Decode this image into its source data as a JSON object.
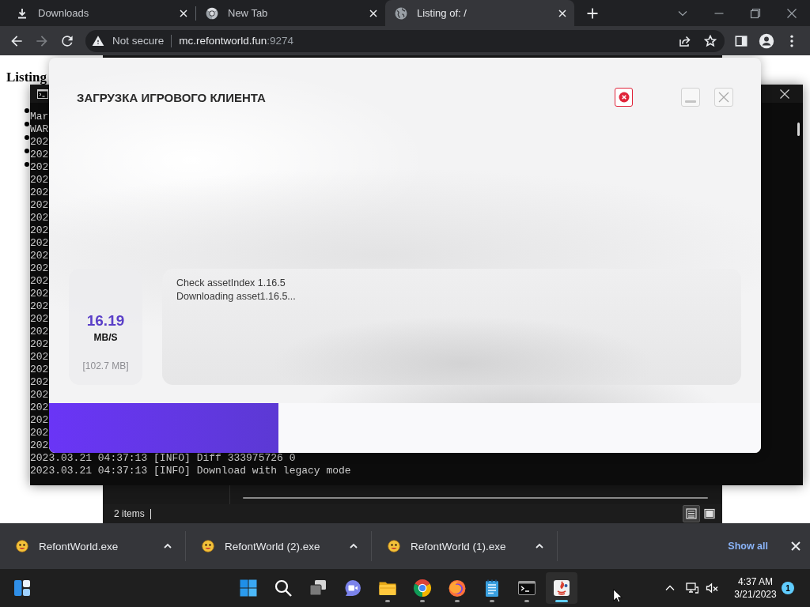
{
  "browser": {
    "tabs": [
      {
        "kind": "downloads",
        "label": "Downloads",
        "selected": false
      },
      {
        "kind": "chrome",
        "label": "New Tab",
        "selected": false
      },
      {
        "kind": "globe",
        "label": "Listing of: /",
        "selected": true
      }
    ]
  },
  "toolbar": {
    "forward_disabled": true,
    "security": "Not secure",
    "host": "mc.refontworld.fun",
    "port": ":9274"
  },
  "page": {
    "heading": "Listing"
  },
  "explorer": {
    "status": "2 items",
    "views": [
      {
        "kind": "details",
        "selected": true
      },
      {
        "kind": "tiles",
        "selected": false
      }
    ]
  },
  "console": {
    "lines": [
      "Mar",
      "WAR",
      "202",
      "202",
      "202",
      "202",
      "202",
      "202",
      "202",
      "202",
      "202",
      "202",
      "202",
      "202",
      "202",
      "202",
      "202",
      "202",
      "202",
      "202",
      "202",
      "202",
      "202",
      "202",
      "202",
      "202",
      "202",
      "2023.03.21 04:37:13 [INFO] Diff 333975726 0",
      "2023.03.21 04:37:13 [INFO] Download with legacy mode"
    ]
  },
  "dialog": {
    "title": "ЗАГРУЗКА ИГРОВОГО КЛИЕНТА",
    "buttons": [
      {
        "kind": "cancel"
      },
      {
        "kind": "minimize"
      },
      {
        "kind": "close"
      }
    ],
    "speed": {
      "value": "16.19",
      "unit": "MB/S",
      "size": "[102.7 MB]"
    },
    "log": [
      "Check assetIndex 1.16.5",
      "Downloading asset1.16.5..."
    ],
    "progress": {
      "level": 0.322
    }
  },
  "downloads": {
    "items": [
      {
        "name": "RefontWorld.exe"
      },
      {
        "name": "RefontWorld (2).exe"
      },
      {
        "name": "RefontWorld (1).exe"
      }
    ],
    "show_all": "Show all"
  },
  "taskbar": {
    "apps": [
      {
        "kind": "start",
        "running": false,
        "selected": false
      },
      {
        "kind": "search",
        "running": false,
        "selected": false
      },
      {
        "kind": "taskview",
        "running": false,
        "selected": false
      },
      {
        "kind": "chat",
        "running": false,
        "selected": false
      },
      {
        "kind": "folder",
        "running": true,
        "selected": false
      },
      {
        "kind": "chrome",
        "running": true,
        "selected": false
      },
      {
        "kind": "firefox",
        "running": true,
        "selected": false
      },
      {
        "kind": "notepad",
        "running": true,
        "selected": false
      },
      {
        "kind": "terminal",
        "running": true,
        "selected": false
      },
      {
        "kind": "app",
        "running": true,
        "selected": true
      }
    ],
    "volume_muted": true,
    "clock": {
      "time": "4:37 AM",
      "date": "3/21/2023"
    },
    "notifications": "1"
  }
}
